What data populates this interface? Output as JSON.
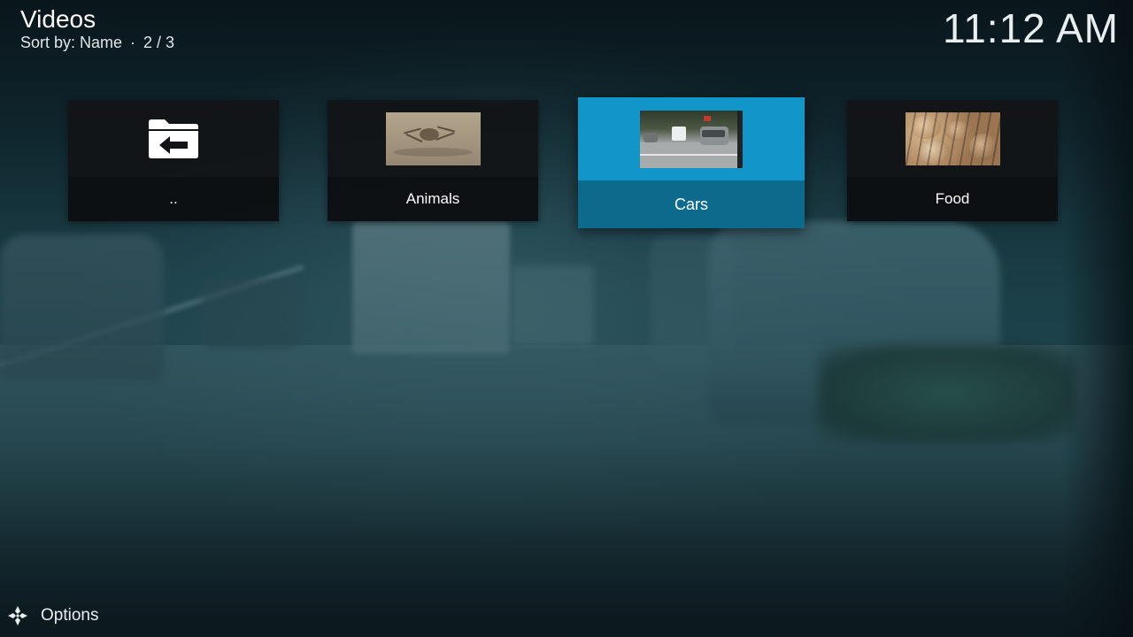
{
  "header": {
    "title": "Videos",
    "sort_label": "Sort by: Name",
    "separator": "·",
    "position": "2 / 3",
    "clock": "11:12 AM"
  },
  "items": [
    {
      "label": "..",
      "icon": "folder-back-icon",
      "focused": false
    },
    {
      "label": "Animals",
      "thumbnail": "crab",
      "focused": false
    },
    {
      "label": "Cars",
      "thumbnail": "cars",
      "focused": true
    },
    {
      "label": "Food",
      "thumbnail": "food",
      "focused": false
    }
  ],
  "footer": {
    "options_label": "Options",
    "options_icon": "options-icon"
  },
  "colors": {
    "focus_top": "#1295c8",
    "focus_bottom": "#0c6a8c",
    "tile_bg": "#121416"
  }
}
